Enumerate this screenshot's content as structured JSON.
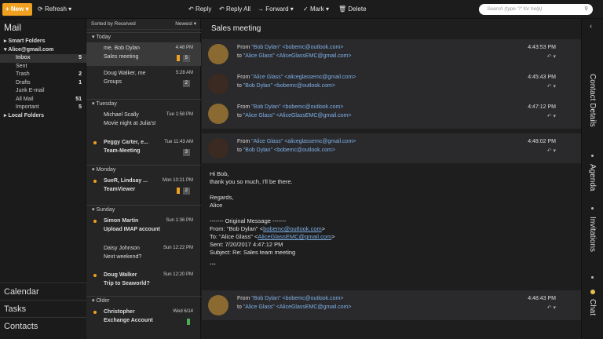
{
  "toolbar": {
    "new_label": "New",
    "refresh_label": "Refresh",
    "reply_label": "Reply",
    "reply_all_label": "Reply All",
    "forward_label": "Forward",
    "mark_label": "Mark",
    "delete_label": "Delete",
    "search_placeholder": "Search (type '?' for help)"
  },
  "folders": {
    "title": "Mail",
    "items": [
      {
        "label": "Smart Folders",
        "count": ""
      },
      {
        "label": "Alice@gmail.com",
        "count": ""
      },
      {
        "label": "Inbox",
        "count": "5"
      },
      {
        "label": "Sent",
        "count": ""
      },
      {
        "label": "Trash",
        "count": "2"
      },
      {
        "label": "Drafts",
        "count": "1"
      },
      {
        "label": "Junk E-mail",
        "count": ""
      },
      {
        "label": "All Mail",
        "count": "51"
      },
      {
        "label": "Important",
        "count": "5"
      },
      {
        "label": "Local Folders",
        "count": ""
      }
    ],
    "nav": [
      "Calendar",
      "Tasks",
      "Contacts"
    ]
  },
  "list": {
    "sort_label": "Sorted by Received",
    "order_label": "Newest",
    "groups": [
      "Today",
      "Tuesday",
      "Monday",
      "Sunday",
      "Older"
    ],
    "messages": [
      {
        "from": "me, Bob Dylan",
        "time": "4:48 PM",
        "subject": "Sales meeting",
        "count": "5"
      },
      {
        "from": "Doug Walker, me",
        "time": "5:28 AM",
        "subject": "Groups",
        "count": "2"
      },
      {
        "from": "Michael Scally",
        "time": "Tue 1:58 PM",
        "subject": "Movie night at Julia's!",
        "count": ""
      },
      {
        "from": "Peggy Carter, e...",
        "time": "Tue 11:43 AM",
        "subject": "Team-Meeting",
        "count": "3"
      },
      {
        "from": "SueR, Lindsay ...",
        "time": "Mon 10:21 PM",
        "subject": "TeamViewer",
        "count": "2"
      },
      {
        "from": "Simon Martin",
        "time": "Sun 1:36 PM",
        "subject": "Upload IMAP account",
        "count": ""
      },
      {
        "from": "Daisy Johnson",
        "time": "Sun 12:22 PM",
        "subject": "Next weekend?",
        "count": ""
      },
      {
        "from": "Doug Walker",
        "time": "Sun 12:20 PM",
        "subject": "Trip to Seaworld?",
        "count": ""
      },
      {
        "from": "Christopher",
        "time": "Wed 6/14",
        "subject": "Exchange Account",
        "count": ""
      }
    ]
  },
  "reader": {
    "subject": "Sales meeting",
    "from_prefix": "From",
    "to_prefix": "to",
    "emails": [
      {
        "from": "\"Bob Dylan\" <bobemc@outlook.com>",
        "to": "\"Alice Glass\" <AliceGlassEMC@gmail.com>",
        "time": "4:43:53 PM"
      },
      {
        "from": "\"Alice Glass\" <aliceglassemc@gmail.com>",
        "to": "\"Bob Dylan\" <bobemc@outlook.com>",
        "time": "4:45:43 PM"
      },
      {
        "from": "\"Bob Dylan\" <bobemc@outlook.com>",
        "to": "\"Alice Glass\" <AliceGlassEMC@gmail.com>",
        "time": "4:47:12 PM"
      },
      {
        "from": "\"Alice Glass\" <aliceglassemc@gmail.com>",
        "to": "\"Bob Dylan\" <bobemc@outlook.com>",
        "time": "4:48:02 PM"
      },
      {
        "from": "\"Bob Dylan\" <bobemc@outlook.com>",
        "to": "\"Alice Glass\" <AliceGlassEMC@gmail.com>",
        "time": "4:48:43 PM"
      }
    ],
    "body": {
      "l1": "Hi Bob,",
      "l2": "thank you so much, I'll be there.",
      "l3": "Regards,",
      "l4": "Alice",
      "l5": "------- Original Message -------",
      "l6a": "From: \"Bob Dylan\" <",
      "l6b": "bobemc@outlook.com",
      "l6c": ">",
      "l7a": "To: \"Alice Glass\" <",
      "l7b": "AliceGlassEMC@gmail.com",
      "l7c": ">",
      "l8": "Sent: 7/20/2017 4:47:12 PM",
      "l9": "Subject: Re: Sales team meeting",
      "l10": "•••"
    }
  },
  "sidebar_right": [
    "Contact Details",
    "Agenda",
    "Invitations",
    "Chat"
  ]
}
